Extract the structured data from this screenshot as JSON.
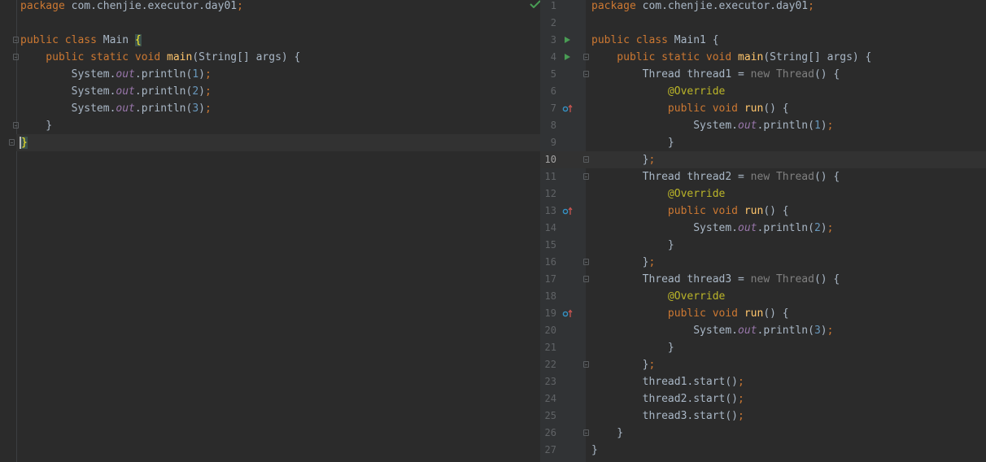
{
  "left_editor": {
    "lines": [
      [
        {
          "t": "package",
          "c": "kw"
        },
        {
          "t": " com.chenjie.executor.day01",
          "c": "pl"
        },
        {
          "t": ";",
          "c": "semi"
        }
      ],
      [],
      [
        {
          "t": "public class",
          "c": "kw"
        },
        {
          "t": " Main ",
          "c": "pl"
        },
        {
          "t": "{",
          "c": "brace-hl"
        }
      ],
      [
        {
          "t": "    public static void ",
          "c": "kw"
        },
        {
          "t": "main",
          "c": "fn"
        },
        {
          "t": "(String[] args) {",
          "c": "pl"
        }
      ],
      [
        {
          "t": "        System.",
          "c": "pl"
        },
        {
          "t": "out",
          "c": "st"
        },
        {
          "t": ".println(",
          "c": "pl"
        },
        {
          "t": "1",
          "c": "num"
        },
        {
          "t": ")",
          "c": "pl"
        },
        {
          "t": ";",
          "c": "semi"
        }
      ],
      [
        {
          "t": "        System.",
          "c": "pl"
        },
        {
          "t": "out",
          "c": "st"
        },
        {
          "t": ".println(",
          "c": "pl"
        },
        {
          "t": "2",
          "c": "num"
        },
        {
          "t": ")",
          "c": "pl"
        },
        {
          "t": ";",
          "c": "semi"
        }
      ],
      [
        {
          "t": "        System.",
          "c": "pl"
        },
        {
          "t": "out",
          "c": "st"
        },
        {
          "t": ".println(",
          "c": "pl"
        },
        {
          "t": "3",
          "c": "num"
        },
        {
          "t": ")",
          "c": "pl"
        },
        {
          "t": ";",
          "c": "semi"
        }
      ],
      [
        {
          "t": "    }",
          "c": "pl"
        }
      ],
      [
        {
          "t": "}",
          "c": "brace-hl"
        }
      ]
    ],
    "current_line": 8,
    "inspection_status": "check-icon"
  },
  "right_editor": {
    "lines": [
      [
        {
          "t": "package",
          "c": "kw"
        },
        {
          "t": " com.chenjie.executor.day01",
          "c": "pl"
        },
        {
          "t": ";",
          "c": "semi"
        }
      ],
      [],
      [
        {
          "t": "public class",
          "c": "kw"
        },
        {
          "t": " Main1 {",
          "c": "pl"
        }
      ],
      [
        {
          "t": "    public static void ",
          "c": "kw"
        },
        {
          "t": "main",
          "c": "fn"
        },
        {
          "t": "(String[] args) {",
          "c": "pl"
        }
      ],
      [
        {
          "t": "        Thread thread1 = ",
          "c": "pl"
        },
        {
          "t": "new ",
          "c": "gr"
        },
        {
          "t": "Thread",
          "c": "gr"
        },
        {
          "t": "() {",
          "c": "pl"
        }
      ],
      [
        {
          "t": "            @Override",
          "c": "an"
        }
      ],
      [
        {
          "t": "            public void ",
          "c": "kw"
        },
        {
          "t": "run",
          "c": "fn"
        },
        {
          "t": "() {",
          "c": "pl"
        }
      ],
      [
        {
          "t": "                System.",
          "c": "pl"
        },
        {
          "t": "out",
          "c": "st"
        },
        {
          "t": ".println(",
          "c": "pl"
        },
        {
          "t": "1",
          "c": "num"
        },
        {
          "t": ")",
          "c": "pl"
        },
        {
          "t": ";",
          "c": "semi"
        }
      ],
      [
        {
          "t": "            }",
          "c": "pl"
        }
      ],
      [
        {
          "t": "        }",
          "c": "pl"
        },
        {
          "t": ";",
          "c": "semi"
        }
      ],
      [
        {
          "t": "        Thread thread2 = ",
          "c": "pl"
        },
        {
          "t": "new ",
          "c": "gr"
        },
        {
          "t": "Thread",
          "c": "gr"
        },
        {
          "t": "() {",
          "c": "pl"
        }
      ],
      [
        {
          "t": "            @Override",
          "c": "an"
        }
      ],
      [
        {
          "t": "            public void ",
          "c": "kw"
        },
        {
          "t": "run",
          "c": "fn"
        },
        {
          "t": "() {",
          "c": "pl"
        }
      ],
      [
        {
          "t": "                System.",
          "c": "pl"
        },
        {
          "t": "out",
          "c": "st"
        },
        {
          "t": ".println(",
          "c": "pl"
        },
        {
          "t": "2",
          "c": "num"
        },
        {
          "t": ")",
          "c": "pl"
        },
        {
          "t": ";",
          "c": "semi"
        }
      ],
      [
        {
          "t": "            }",
          "c": "pl"
        }
      ],
      [
        {
          "t": "        }",
          "c": "pl"
        },
        {
          "t": ";",
          "c": "semi"
        }
      ],
      [
        {
          "t": "        Thread thread3 = ",
          "c": "pl"
        },
        {
          "t": "new ",
          "c": "gr"
        },
        {
          "t": "Thread",
          "c": "gr"
        },
        {
          "t": "() {",
          "c": "pl"
        }
      ],
      [
        {
          "t": "            @Override",
          "c": "an"
        }
      ],
      [
        {
          "t": "            public void ",
          "c": "kw"
        },
        {
          "t": "run",
          "c": "fn"
        },
        {
          "t": "() {",
          "c": "pl"
        }
      ],
      [
        {
          "t": "                System.",
          "c": "pl"
        },
        {
          "t": "out",
          "c": "st"
        },
        {
          "t": ".println(",
          "c": "pl"
        },
        {
          "t": "3",
          "c": "num"
        },
        {
          "t": ")",
          "c": "pl"
        },
        {
          "t": ";",
          "c": "semi"
        }
      ],
      [
        {
          "t": "            }",
          "c": "pl"
        }
      ],
      [
        {
          "t": "        }",
          "c": "pl"
        },
        {
          "t": ";",
          "c": "semi"
        }
      ],
      [
        {
          "t": "        thread1.start()",
          "c": "pl"
        },
        {
          "t": ";",
          "c": "semi"
        }
      ],
      [
        {
          "t": "        thread2.start()",
          "c": "pl"
        },
        {
          "t": ";",
          "c": "semi"
        }
      ],
      [
        {
          "t": "        thread3.start()",
          "c": "pl"
        },
        {
          "t": ";",
          "c": "semi"
        }
      ],
      [
        {
          "t": "    }",
          "c": "pl"
        }
      ],
      [
        {
          "t": "}",
          "c": "pl"
        }
      ]
    ],
    "line_numbers": [
      "1",
      "2",
      "3",
      "4",
      "5",
      "6",
      "7",
      "8",
      "9",
      "10",
      "11",
      "12",
      "13",
      "14",
      "15",
      "16",
      "17",
      "18",
      "19",
      "20",
      "21",
      "22",
      "23",
      "24",
      "25",
      "26",
      "27"
    ],
    "current_line": 9,
    "run_icon_lines": [
      2,
      3
    ],
    "override_icon_lines": [
      6,
      12,
      18
    ],
    "fold_lines": [
      3,
      4,
      9,
      10,
      15,
      16,
      21,
      25
    ]
  },
  "colors": {
    "background": "#2b2b2b",
    "gutter": "#313335",
    "keyword": "#cc7832",
    "function": "#ffc66d",
    "number": "#6897bb",
    "static_field": "#9876aa",
    "annotation": "#bbb529",
    "run_icon": "#499c54"
  }
}
